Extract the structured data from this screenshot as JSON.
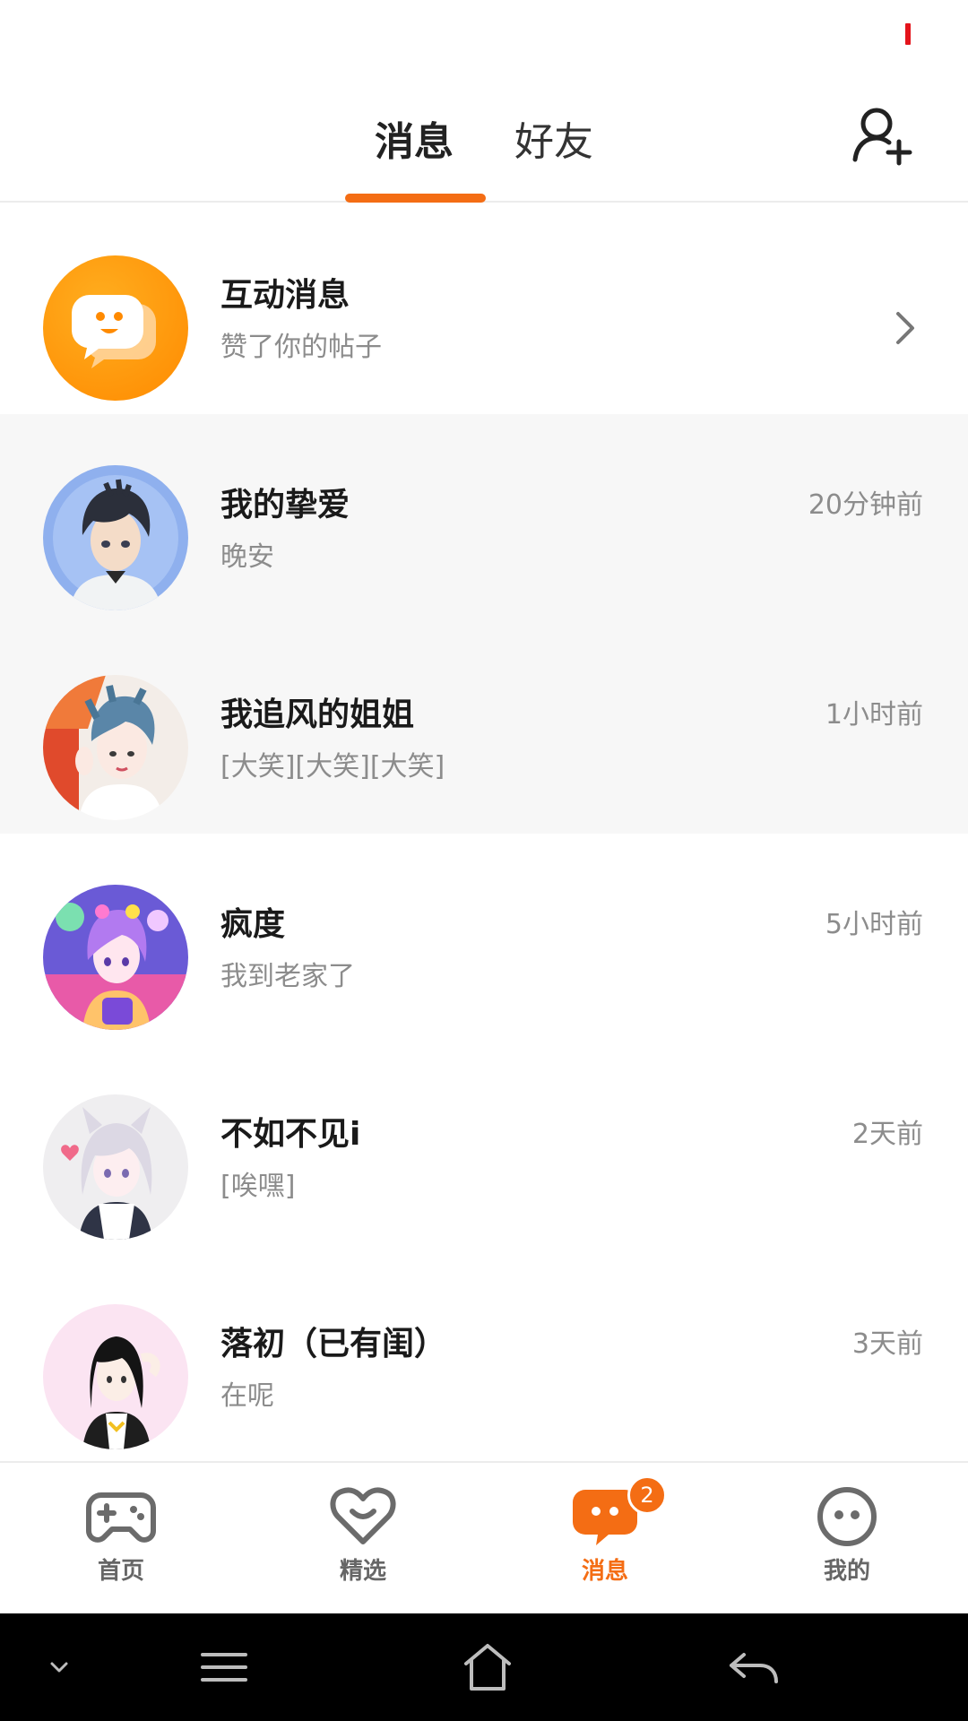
{
  "header": {
    "tabs": [
      {
        "label": "消息",
        "active": true
      },
      {
        "label": "好友",
        "active": false
      }
    ]
  },
  "interaction": {
    "title": "互动消息",
    "preview": "赞了你的帖子"
  },
  "conversations": [
    {
      "name": "我的挚爱",
      "message": "晚安",
      "time": "20分钟前",
      "pinned": true
    },
    {
      "name": "我追风的姐姐",
      "message": "[大笑][大笑][大笑]",
      "time": "1小时前",
      "pinned": true
    },
    {
      "name": "疯度",
      "message": "我到老家了",
      "time": "5小时前",
      "pinned": false
    },
    {
      "name": "不如不见i",
      "message": "[唉嘿]",
      "time": "2天前",
      "pinned": false
    },
    {
      "name": "落初（已有闺）",
      "message": "在呢",
      "time": "3天前",
      "pinned": false
    }
  ],
  "bottom_nav": {
    "items": [
      {
        "label": "首页",
        "icon": "gamepad-icon",
        "active": false
      },
      {
        "label": "精选",
        "icon": "heart-chat-icon",
        "active": false
      },
      {
        "label": "消息",
        "icon": "message-icon",
        "active": true,
        "badge": "2"
      },
      {
        "label": "我的",
        "icon": "face-icon",
        "active": false
      }
    ]
  },
  "system_nav": [
    "chevron-down-icon",
    "menu-icon",
    "home-icon",
    "back-icon"
  ],
  "colors": {
    "accent": "#f46d14",
    "pinned_bg": "#f7f7f7",
    "status_mark": "#e4141b"
  }
}
